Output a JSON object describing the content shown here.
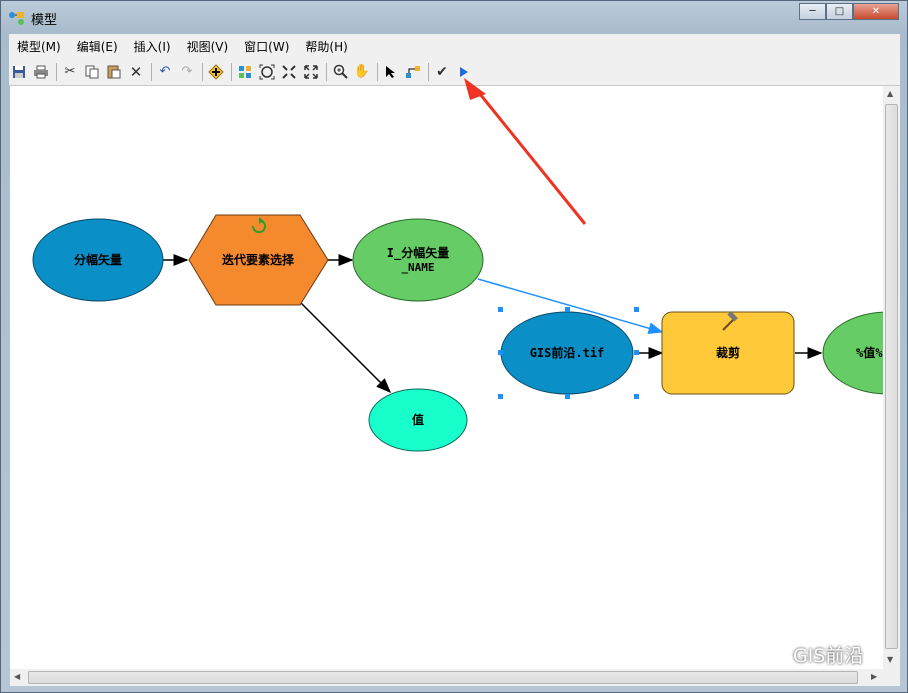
{
  "window": {
    "title": "模型"
  },
  "menu": {
    "items": [
      "模型(M)",
      "编辑(E)",
      "插入(I)",
      "视图(V)",
      "窗口(W)",
      "帮助(H)"
    ]
  },
  "toolbar": {
    "icons": [
      "save-icon",
      "print-icon",
      "cut-icon",
      "copy-icon",
      "paste-icon",
      "delete-icon",
      "undo-icon",
      "redo-icon",
      "add-data-icon",
      "auto-layout-icon",
      "full-extent-icon",
      "fixed-zoom-in-icon",
      "fixed-zoom-out-icon",
      "zoom-in-icon",
      "pan-icon",
      "select-icon",
      "connect-icon",
      "validate-icon",
      "run-icon"
    ]
  },
  "nodes": {
    "fenfu_shiliang": "分幅矢量",
    "diedai": "迭代要素选择",
    "i_fenfu_line1": "I_分幅矢量",
    "i_fenfu_line2": "_NAME",
    "zhi": "值",
    "gis_tif": "GIS前沿.tif",
    "caijian": "裁剪",
    "output": "%值%"
  },
  "colors": {
    "input_data": "#0a8fc6",
    "tool": "#ffc93a",
    "iterator": "#f5892e",
    "derived": "#66cc66",
    "value": "#19ffcc",
    "annotation_arrow": "#ee3322",
    "selection_handle": "#1e90ff"
  },
  "watermark": {
    "text": "GIS前沿"
  }
}
